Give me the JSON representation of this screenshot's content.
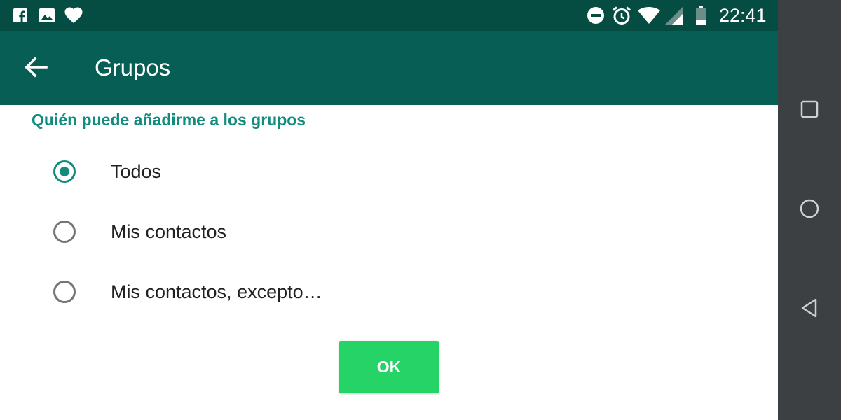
{
  "status_bar": {
    "time": "22:41",
    "left_icons": [
      "facebook-icon",
      "image-icon",
      "heart-icon"
    ],
    "right_icons": [
      "do-not-disturb-icon",
      "alarm-icon",
      "wifi-icon",
      "cell-signal-icon",
      "battery-icon"
    ]
  },
  "app_bar": {
    "title": "Grupos",
    "back_icon": "arrow-back-icon"
  },
  "settings": {
    "section_header": "Quién puede añadirme a los grupos",
    "options": [
      {
        "label": "Todos",
        "selected": true
      },
      {
        "label": "Mis contactos",
        "selected": false
      },
      {
        "label": "Mis contactos, excepto…",
        "selected": false
      }
    ],
    "ok_label": "OK"
  },
  "nav_bar": {
    "buttons": [
      "recents-square-icon",
      "home-circle-icon",
      "back-triangle-icon"
    ]
  },
  "colors": {
    "status_bar": "#054c42",
    "app_bar": "#075e54",
    "accent": "#128c7e",
    "ok_button": "#25d366",
    "nav_bar": "#3c4043"
  }
}
